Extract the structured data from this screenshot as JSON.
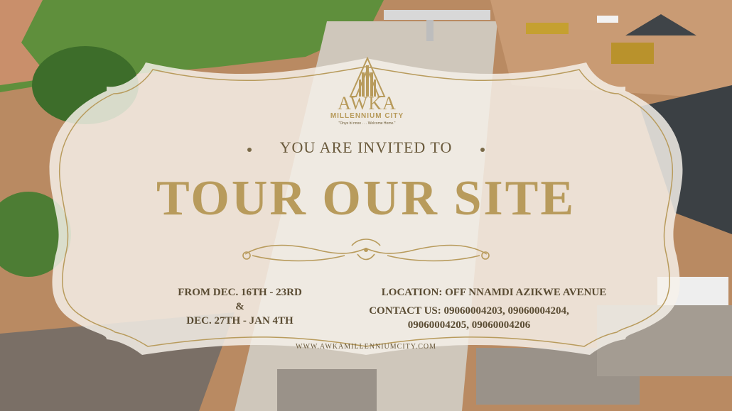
{
  "logo": {
    "name": "AWKA",
    "sub": "MILLENNIUM CITY",
    "tagline": "\"Onye bi nnoo . . . Welcome Home.\""
  },
  "invite": {
    "line1": "YOU ARE INVITED TO",
    "headline": "TOUR OUR SITE"
  },
  "details": {
    "dates_line1": "FROM DEC. 16TH - 23RD",
    "dates_amp": "&",
    "dates_line2": "DEC. 27TH - JAN 4TH",
    "location": "LOCATION: OFF NNAMDI AZIKWE AVENUE",
    "contact_line1": "CONTACT US: 09060004203, 09060004204,",
    "contact_line2": "09060004205, 09060004206"
  },
  "website": "WWW.AWKAMILLENNIUMCITY.COM",
  "colors": {
    "gold": "#b89b5c",
    "text_brown": "#5a4c33"
  }
}
